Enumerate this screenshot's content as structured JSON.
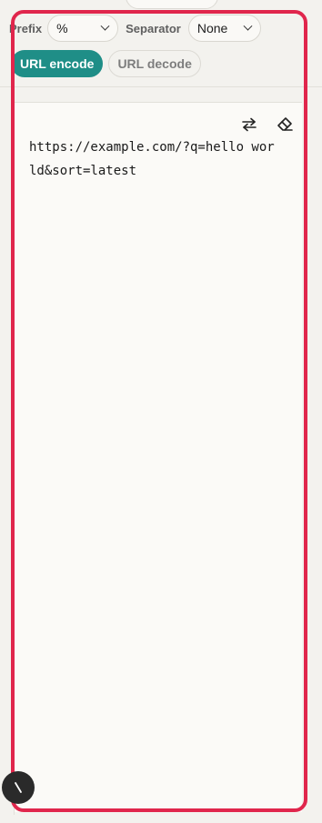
{
  "options": {
    "prefix_label": "Prefix",
    "prefix_value": "%",
    "separator_label": "Separator",
    "separator_value": "None"
  },
  "modes": {
    "encode_label": "URL encode",
    "decode_label": "URL decode",
    "active": "encode"
  },
  "editor": {
    "text": "https://example.com/?q=hello world&sort=latest"
  },
  "icons": {
    "swap": "swap-arrows-icon",
    "clear": "eraser-icon",
    "fab": "n-logo-icon"
  },
  "colors": {
    "accent": "#1f8e87",
    "highlight": "#e0264c",
    "background": "#f3f2ee",
    "panel": "#fbfaf7"
  }
}
